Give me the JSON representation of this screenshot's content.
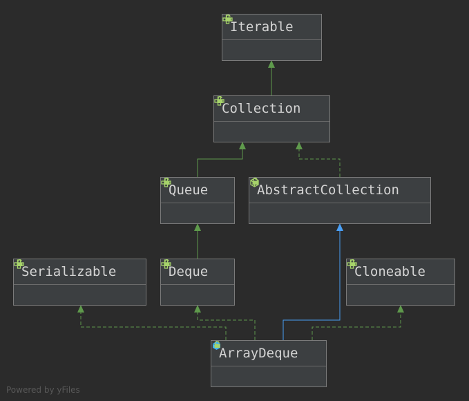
{
  "nodes": [
    {
      "id": "iterable",
      "label": "Iterable",
      "kind": "interface"
    },
    {
      "id": "collection",
      "label": "Collection",
      "kind": "interface"
    },
    {
      "id": "queue",
      "label": "Queue",
      "kind": "interface"
    },
    {
      "id": "abstractcollection",
      "label": "AbstractCollection",
      "kind": "abstract-class"
    },
    {
      "id": "serializable",
      "label": "Serializable",
      "kind": "interface"
    },
    {
      "id": "deque",
      "label": "Deque",
      "kind": "interface"
    },
    {
      "id": "cloneable",
      "label": "Cloneable",
      "kind": "interface"
    },
    {
      "id": "arraydeque",
      "label": "ArrayDeque",
      "kind": "class"
    }
  ],
  "edges": [
    {
      "from": "collection",
      "to": "iterable",
      "type": "extends"
    },
    {
      "from": "queue",
      "to": "collection",
      "type": "extends"
    },
    {
      "from": "abstractcollection",
      "to": "collection",
      "type": "implements"
    },
    {
      "from": "deque",
      "to": "queue",
      "type": "extends"
    },
    {
      "from": "arraydeque",
      "to": "abstractcollection",
      "type": "extends-class"
    },
    {
      "from": "arraydeque",
      "to": "serializable",
      "type": "implements"
    },
    {
      "from": "arraydeque",
      "to": "deque",
      "type": "implements"
    },
    {
      "from": "arraydeque",
      "to": "cloneable",
      "type": "implements"
    }
  ],
  "colors": {
    "interface_edge": "#5f9a4c",
    "class_edge": "#4a9ff5",
    "icon_green": "#a6d36a",
    "class_icon": "#3fb4f5"
  },
  "footer": "Powered by yFiles"
}
